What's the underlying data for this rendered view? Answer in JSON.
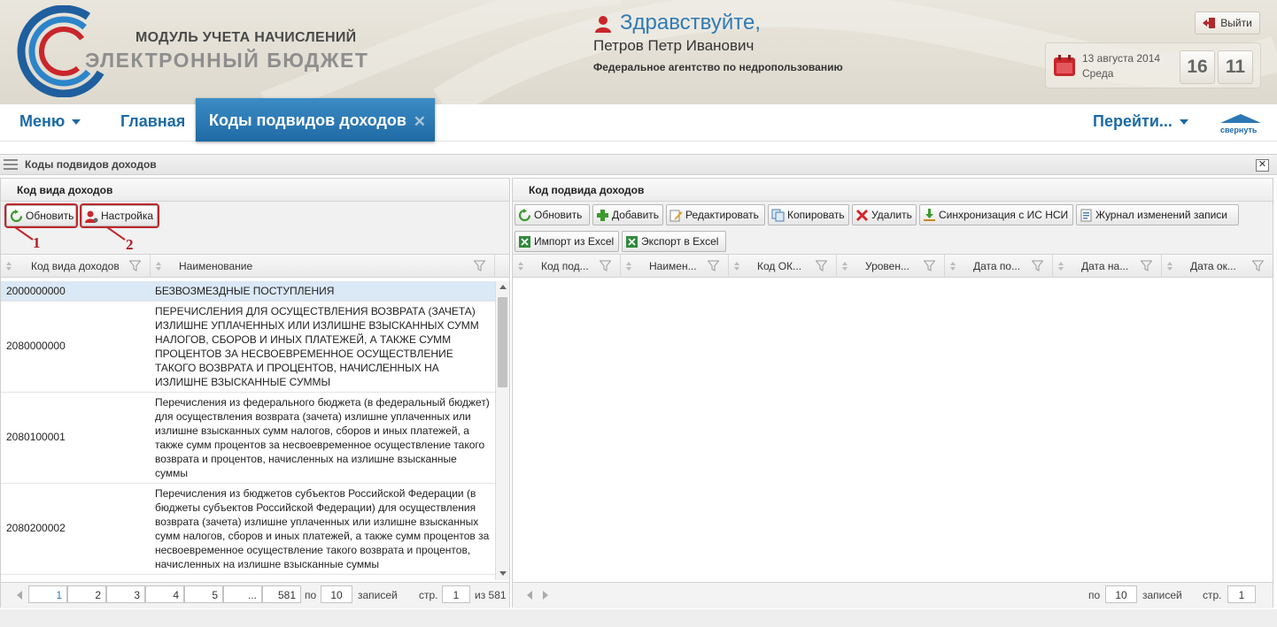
{
  "header": {
    "logo_line1": "МОДУЛЬ УЧЕТА НАЧИСЛЕНИЙ",
    "logo_line2": "ЭЛЕКТРОННЫЙ БЮДЖЕТ",
    "greeting": "Здравствуйте,",
    "user_name": "Петров Петр Иванович",
    "agency": "Федеральное агентство по недропользованию",
    "exit_label": "Выйти",
    "date": "13 августа 2014",
    "weekday": "Среда",
    "hour": "16",
    "minute": "11"
  },
  "nav": {
    "menu_label": "Меню",
    "home_label": "Главная",
    "active_tab": "Коды подвидов доходов",
    "goto_label": "Перейти...",
    "collapse_label": "свернуть"
  },
  "page": {
    "title": "Коды подвидов доходов"
  },
  "left_panel": {
    "title": "Код вида доходов",
    "toolbar": {
      "refresh": "Обновить",
      "settings": "Настройка"
    },
    "annotations": [
      "1",
      "2"
    ],
    "columns": [
      "Код вида доходов",
      "Наименование"
    ],
    "rows": [
      {
        "code": "2000000000",
        "name": "БЕЗВОЗМЕЗДНЫЕ ПОСТУПЛЕНИЯ"
      },
      {
        "code": "2080000000",
        "name": "ПЕРЕЧИСЛЕНИЯ ДЛЯ ОСУЩЕСТВЛЕНИЯ ВОЗВРАТА (ЗАЧЕТА) ИЗЛИШНЕ УПЛАЧЕННЫХ ИЛИ ИЗЛИШНЕ ВЗЫСКАННЫХ СУММ НАЛОГОВ, СБОРОВ И ИНЫХ ПЛАТЕЖЕЙ, А ТАКЖЕ СУММ ПРОЦЕНТОВ ЗА НЕСВОЕВРЕМЕННОЕ ОСУЩЕСТВЛЕНИЕ ТАКОГО ВОЗВРАТА И ПРОЦЕНТОВ, НАЧИСЛЕННЫХ НА ИЗЛИШНЕ ВЗЫСКАННЫЕ СУММЫ"
      },
      {
        "code": "2080100001",
        "name": "Перечисления из федерального бюджета (в федеральный бюджет) для осуществления возврата (зачета) излишне уплаченных или излишне взысканных сумм налогов, сборов и иных платежей, а также сумм процентов за несвоевременное осуществление такого возврата и процентов, начисленных на излишне взысканные суммы"
      },
      {
        "code": "2080200002",
        "name": "Перечисления из бюджетов субъектов Российской Федерации (в бюджеты субъектов Российской Федерации) для осуществления возврата (зачета) излишне уплаченных или излишне взысканных сумм налогов, сборов и иных платежей, а также сумм процентов за несвоевременное осуществление такого возврата и процентов, начисленных на излишне взысканные суммы"
      }
    ],
    "pager": {
      "pages": [
        "1",
        "2",
        "3",
        "4",
        "5",
        "...",
        "581"
      ],
      "po_label": "по",
      "per_page": "10",
      "records_label": "записей",
      "page_label": "стр.",
      "current_page": "1",
      "of_label": "из 581"
    }
  },
  "right_panel": {
    "title": "Код подвида доходов",
    "toolbar": {
      "refresh": "Обновить",
      "add": "Добавить",
      "edit": "Редактировать",
      "copy": "Копировать",
      "delete": "Удалить",
      "sync": "Синхронизация с ИС НСИ",
      "journal": "Журнал изменений записи",
      "import": "Импорт из Excel",
      "export": "Экспорт в Excel"
    },
    "columns": [
      "Код под...",
      "Наимен...",
      "Код ОК...",
      "Уровен...",
      "Дата по...",
      "Дата на...",
      "Дата ок..."
    ],
    "pager": {
      "po_label": "по",
      "per_page": "10",
      "records_label": "записей",
      "page_label": "стр.",
      "current_page": "1"
    }
  },
  "colors": {
    "accent": "#1d6aa5",
    "tab_active": "#2b78b4",
    "annotation": "#c0262c",
    "selected_row": "#dbe8f5"
  }
}
